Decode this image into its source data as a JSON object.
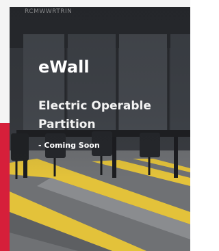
{
  "card": {
    "top_caption": "RCMWWRTRIN",
    "brand": "eWall",
    "title": "Electric Operable Partition",
    "subtitle": "- Coming Soon"
  },
  "colors": {
    "accent_red": "#d61f3a",
    "stripe_yellow": "#e3c23a",
    "carpet_grey": "#7d7f82"
  }
}
